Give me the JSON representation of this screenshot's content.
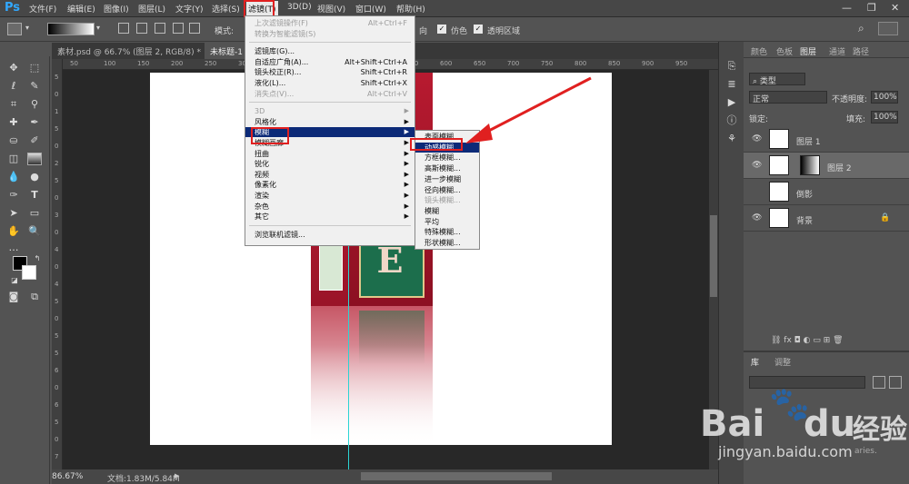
{
  "app": {
    "logo": "Ps",
    "menu": [
      "文件(F)",
      "编辑(E)",
      "图像(I)",
      "图层(L)",
      "文字(Y)",
      "选择(S)",
      "滤镜(T)",
      "3D(D)",
      "视图(V)",
      "窗口(W)",
      "帮助(H)"
    ],
    "active_menu": "滤镜(T)"
  },
  "options_bar": {
    "mode_label": "模式:",
    "reverse_label": "向",
    "dither_label": "仿色",
    "transparency_label": "透明区域"
  },
  "doc_tabs": [
    {
      "label": "素材.psd @ 66.7% (图层 2, RGB/8) *",
      "close": "×"
    },
    {
      "label": "未标题-1",
      "close": ""
    }
  ],
  "filter_menu": {
    "items": [
      {
        "label": "上次滤镜操作(F)",
        "shortcut": "Alt+Ctrl+F",
        "disabled": true
      },
      {
        "label": "转换为智能滤镜(S)",
        "shortcut": "",
        "disabled": true,
        "sep_after": true
      },
      {
        "label": "滤镜库(G)...",
        "shortcut": "",
        "disabled": false
      },
      {
        "label": "自适应广角(A)...",
        "shortcut": "Alt+Shift+Ctrl+A",
        "disabled": false
      },
      {
        "label": "镜头校正(R)...",
        "shortcut": "Shift+Ctrl+R",
        "disabled": false
      },
      {
        "label": "液化(L)...",
        "shortcut": "Shift+Ctrl+X",
        "disabled": false
      },
      {
        "label": "消失点(V)...",
        "shortcut": "Alt+Ctrl+V",
        "disabled": true,
        "sep_after": true
      },
      {
        "label": "3D",
        "shortcut": "",
        "disabled": true,
        "submenu": true
      },
      {
        "label": "风格化",
        "shortcut": "",
        "disabled": false,
        "submenu": true
      },
      {
        "label": "模糊",
        "shortcut": "",
        "disabled": false,
        "submenu": true,
        "highlight": true
      },
      {
        "label": "模糊画廊",
        "shortcut": "",
        "disabled": false,
        "submenu": true
      },
      {
        "label": "扭曲",
        "shortcut": "",
        "disabled": false,
        "submenu": true
      },
      {
        "label": "锐化",
        "shortcut": "",
        "disabled": false,
        "submenu": true
      },
      {
        "label": "视频",
        "shortcut": "",
        "disabled": false,
        "submenu": true
      },
      {
        "label": "像素化",
        "shortcut": "",
        "disabled": false,
        "submenu": true
      },
      {
        "label": "渲染",
        "shortcut": "",
        "disabled": false,
        "submenu": true
      },
      {
        "label": "杂色",
        "shortcut": "",
        "disabled": false,
        "submenu": true
      },
      {
        "label": "其它",
        "shortcut": "",
        "disabled": false,
        "submenu": true,
        "sep_after": true
      },
      {
        "label": "浏览联机滤镜...",
        "shortcut": "",
        "disabled": false
      }
    ]
  },
  "blur_submenu": {
    "items": [
      {
        "label": "表面模糊...",
        "disabled": false
      },
      {
        "label": "动感模糊...",
        "disabled": false,
        "highlight": true
      },
      {
        "label": "方框模糊...",
        "disabled": false
      },
      {
        "label": "高斯模糊...",
        "disabled": false
      },
      {
        "label": "进一步模糊",
        "disabled": false
      },
      {
        "label": "径向模糊...",
        "disabled": false
      },
      {
        "label": "镜头模糊...",
        "disabled": true
      },
      {
        "label": "模糊",
        "disabled": false
      },
      {
        "label": "平均",
        "disabled": false
      },
      {
        "label": "特殊模糊...",
        "disabled": false
      },
      {
        "label": "形状模糊...",
        "disabled": false
      }
    ]
  },
  "layers_panel": {
    "tabs": [
      "颜色",
      "色板",
      "图层",
      "通道",
      "路径"
    ],
    "active_tab": "图层",
    "filter_kind": "类型",
    "blend_mode": "正常",
    "opacity_label": "不透明度:",
    "opacity_value": "100%",
    "lock_label": "锁定:",
    "fill_label": "填充:",
    "fill_value": "100%",
    "layers": [
      {
        "name": "图层 1",
        "visible": true,
        "selected": false
      },
      {
        "name": "图层 2",
        "visible": true,
        "selected": true
      },
      {
        "name": "倒影",
        "visible": false,
        "selected": false
      },
      {
        "name": "背景",
        "visible": true,
        "selected": false,
        "locked": true
      }
    ]
  },
  "library_panel": {
    "tabs": [
      "库",
      "调整"
    ],
    "text": "aries."
  },
  "status": {
    "zoom": "86.67%",
    "doc_info": "文档:1.83M/5.84M"
  },
  "ruler_top_labels": [
    "50",
    "100",
    "150",
    "200",
    "250",
    "300",
    "350",
    "400",
    "450",
    "500",
    "550",
    "600",
    "650",
    "700",
    "750",
    "800",
    "850",
    "900",
    "950"
  ],
  "ruler_left_labels": [
    "5",
    "0",
    "1",
    "5",
    "0",
    "2",
    "5",
    "0",
    "3",
    "0",
    "4",
    "0",
    "4",
    "5",
    "0",
    "5",
    "5",
    "6",
    "0",
    "6",
    "5",
    "0",
    "7"
  ],
  "watermark": {
    "brand": "Bai",
    "brand2": "du",
    "cn": "经验",
    "url": "jingyan.baidu.com"
  },
  "colors": {
    "highlight": "#0c2a78",
    "annotation": "#e02020",
    "guide": "#2bd4d4"
  }
}
